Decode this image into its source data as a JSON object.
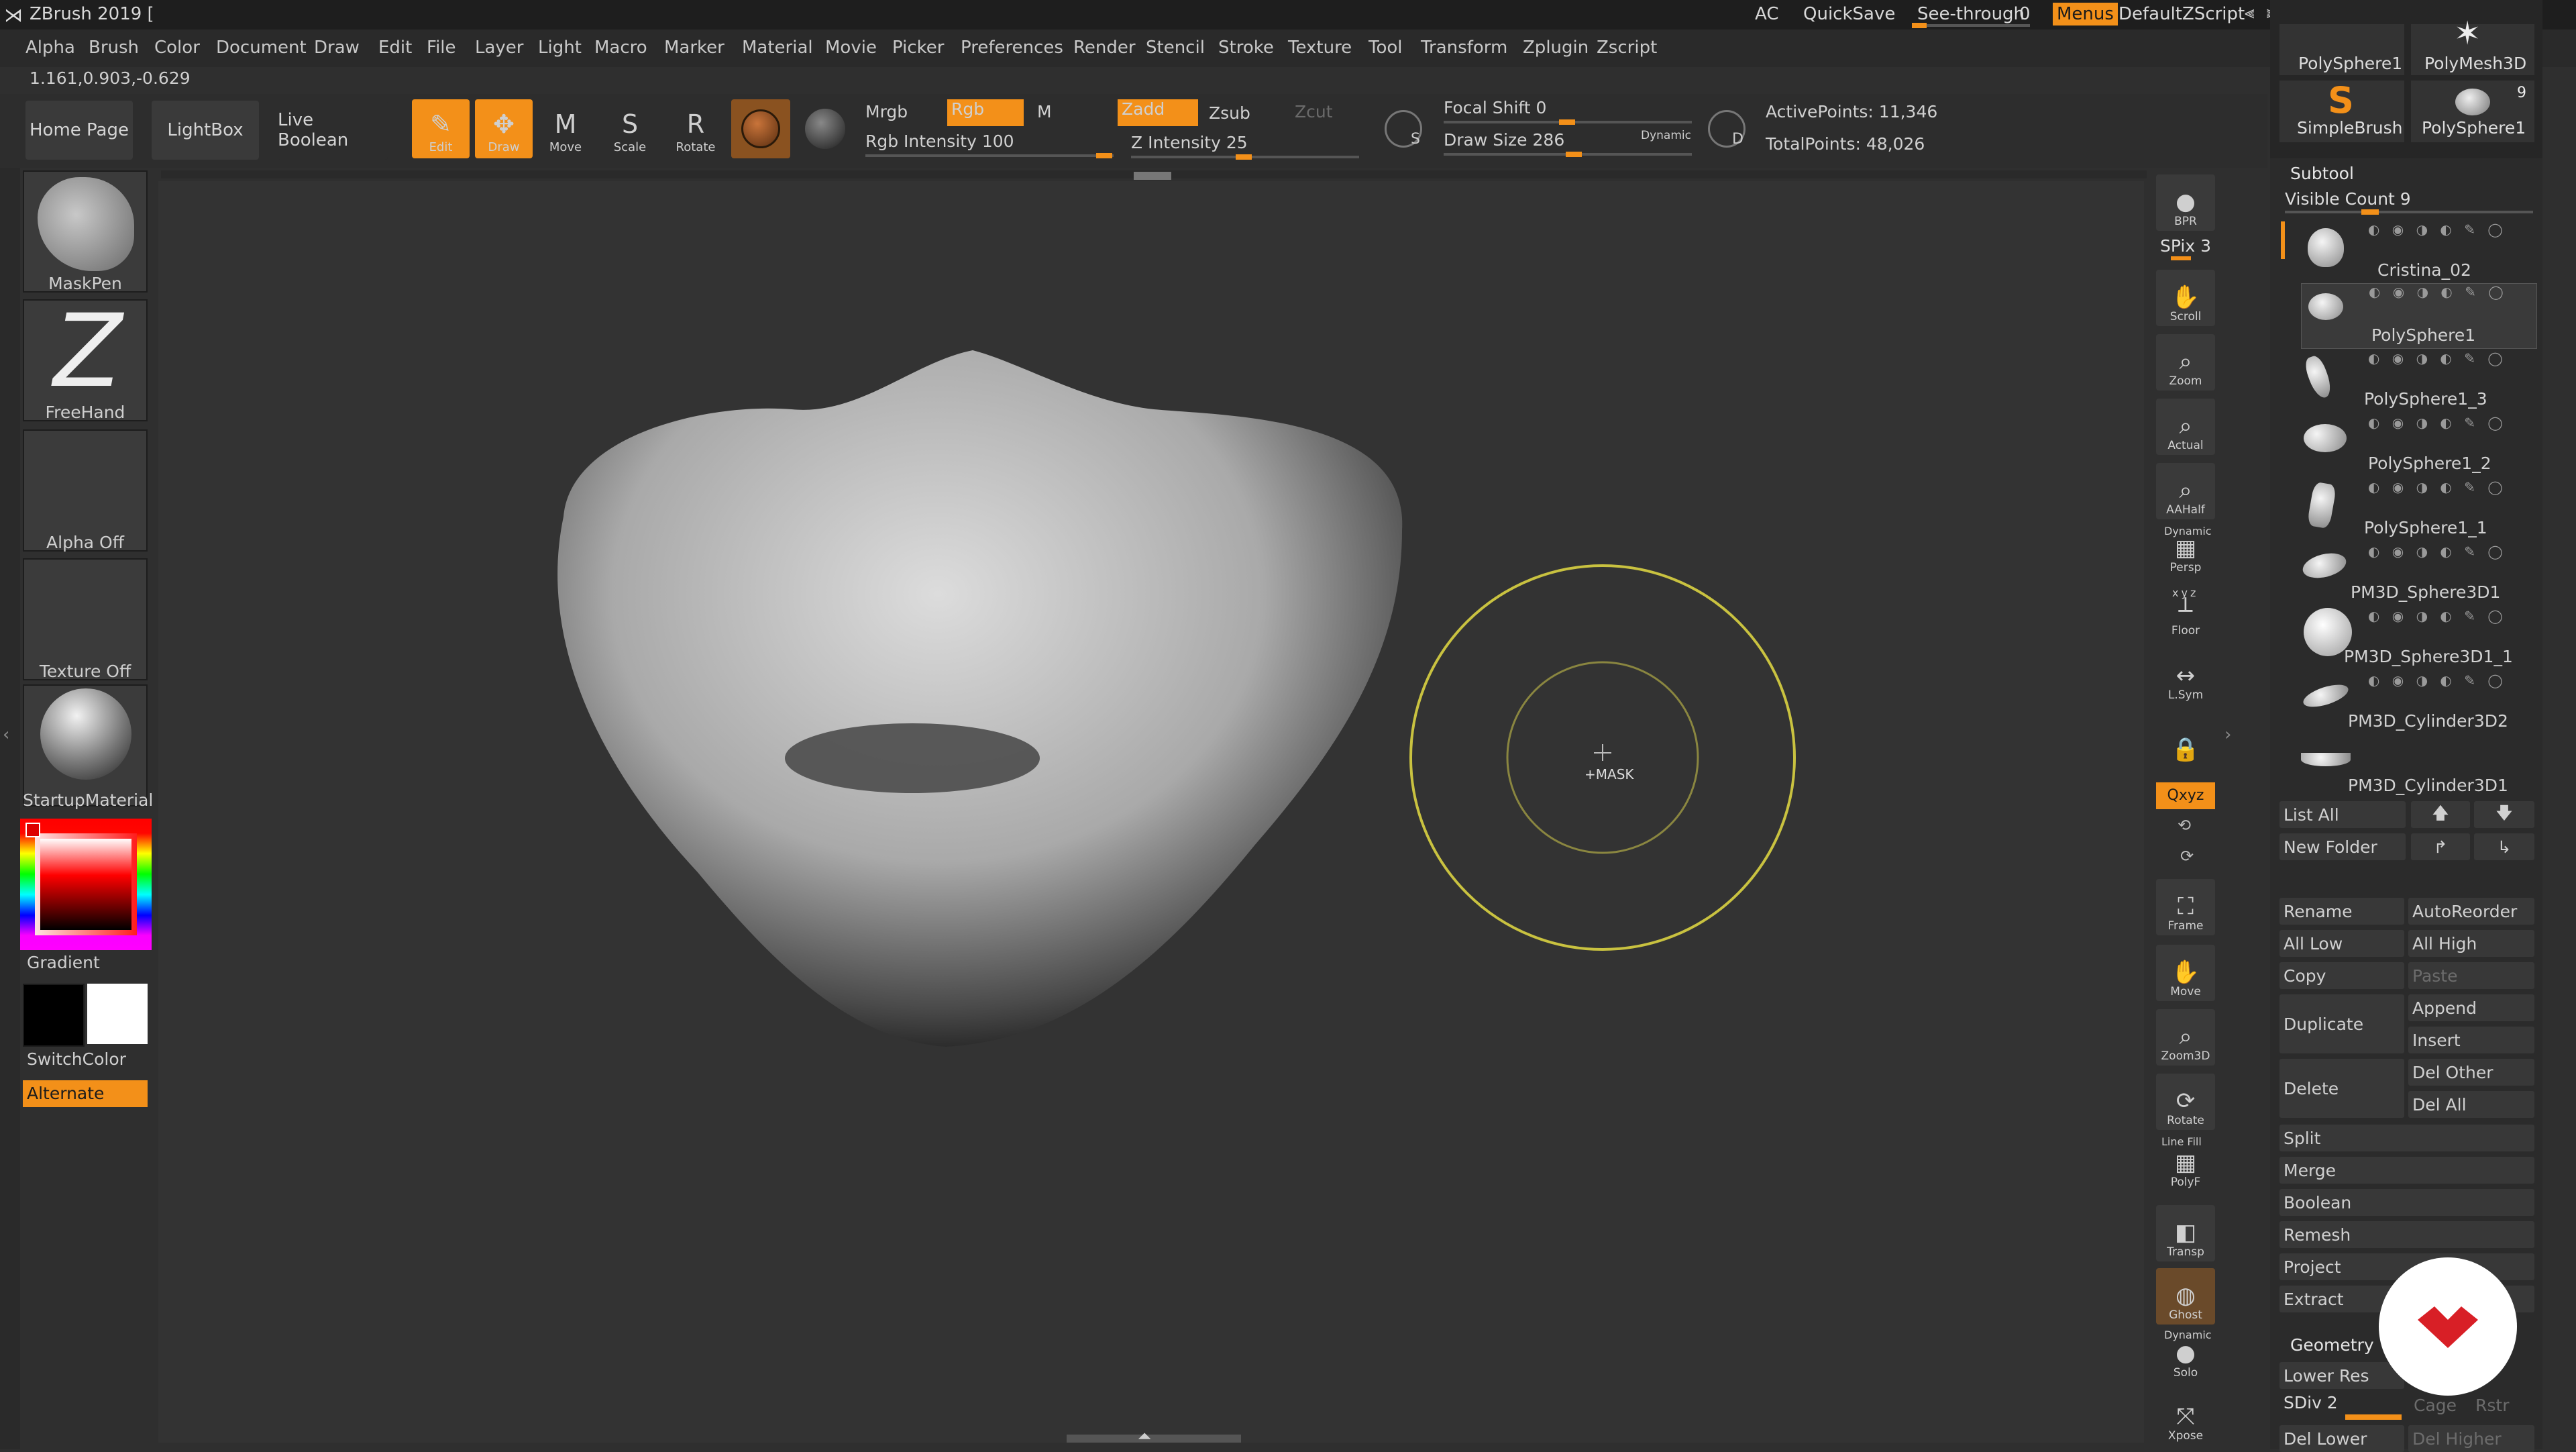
{
  "title": {
    "app_title": "ZBrush 2019 [",
    "ac": "AC",
    "quicksave": "QuickSave",
    "see_through": "See-through",
    "see_through_value": "0",
    "menus": "Menus",
    "script": "DefaultZScript"
  },
  "menus": [
    "Alpha",
    "Brush",
    "Color",
    "Document",
    "Draw",
    "Edit",
    "File",
    "Layer",
    "Light",
    "Macro",
    "Marker",
    "Material",
    "Movie",
    "Picker",
    "Preferences",
    "Render",
    "Stencil",
    "Stroke",
    "Texture",
    "Tool",
    "Transform",
    "Zplugin",
    "Zscript"
  ],
  "coords": "1.161,0.903,-0.629",
  "shelf": {
    "home_page": "Home Page",
    "lightbox": "LightBox",
    "live_boolean": "Live Boolean",
    "tools": [
      {
        "label": "Edit",
        "glyph": "✎",
        "active": true
      },
      {
        "label": "Draw",
        "glyph": "✥",
        "active": true
      },
      {
        "label": "Move",
        "glyph": "M",
        "active": false
      },
      {
        "label": "Scale",
        "glyph": "S",
        "active": false
      },
      {
        "label": "Rotate",
        "glyph": "R",
        "active": false
      }
    ],
    "mrgb": "Mrgb",
    "rgb": "Rgb",
    "m": "M",
    "rgb_intensity_label": "Rgb Intensity 100",
    "zadd": "Zadd",
    "zsub": "Zsub",
    "zcut": "Zcut",
    "z_intensity_label": "Z Intensity 25",
    "focal_shift_label": "Focal Shift 0",
    "draw_size_label": "Draw Size 286",
    "dynamic": "Dynamic",
    "s_badge": "S",
    "d_badge": "D",
    "active_points": "ActivePoints: 11,346",
    "total_points": "TotalPoints: 48,026"
  },
  "left_panel": {
    "maskpen": "MaskPen",
    "freehand": "FreeHand",
    "alpha_off": "Alpha Off",
    "texture_off": "Texture Off",
    "startup_material": "StartupMaterial",
    "gradient": "Gradient",
    "switch_color": "SwitchColor",
    "alternate": "Alternate"
  },
  "cursor_label": "+MASK",
  "right_toolbar": [
    {
      "label": "BPR",
      "glyph": "●"
    },
    {
      "label": "Scroll",
      "glyph": "✋"
    },
    {
      "label": "Zoom",
      "glyph": "⌕"
    },
    {
      "label": "Actual",
      "glyph": "⌕"
    },
    {
      "label": "AAHalf",
      "glyph": "⌕"
    },
    {
      "label": "Persp",
      "glyph": "▦"
    },
    {
      "label": "Floor",
      "glyph": "┴"
    },
    {
      "label": "L.Sym",
      "glyph": "↔"
    },
    {
      "label": "",
      "glyph": "🔒"
    },
    {
      "label": "Frame",
      "glyph": "⛶"
    },
    {
      "label": "Move",
      "glyph": "✋"
    },
    {
      "label": "Zoom3D",
      "glyph": "⌕"
    },
    {
      "label": "Rotate",
      "glyph": "⟳"
    },
    {
      "label": "PolyF",
      "glyph": "▦"
    },
    {
      "label": "Transp",
      "glyph": "◧"
    },
    {
      "label": "Ghost",
      "glyph": "◍"
    },
    {
      "label": "Solo",
      "glyph": "●"
    },
    {
      "label": "Xpose",
      "glyph": "⤧"
    }
  ],
  "right_toolbar_extra": {
    "spix": "SPix 3",
    "dynamic_persp": "Dynamic",
    "xyz_label": "xyz",
    "qxyz": "Qxyz",
    "line_fill": "Line Fill",
    "dynamic_solo": "Dynamic"
  },
  "tool_thumbs": {
    "polysphere1_top": "PolySphere1",
    "polymesh3d": "PolyMesh3D",
    "simplebrush": "SimpleBrush",
    "polysphere1_b": "PolySphere1",
    "count": "9"
  },
  "subtool": {
    "header": "Subtool",
    "visible_count": "Visible Count 9",
    "items": [
      "Cristina_02",
      "PolySphere1",
      "PolySphere1_3",
      "PolySphere1_2",
      "PolySphere1_1",
      "PM3D_Sphere3D1",
      "PM3D_Sphere3D1_1",
      "PM3D_Cylinder3D2",
      "PM3D_Cylinder3D1"
    ],
    "list_all": "List All",
    "new_folder": "New Folder",
    "rename": "Rename",
    "autoreorder": "AutoReorder",
    "all_low": "All Low",
    "all_high": "All High",
    "copy": "Copy",
    "paste": "Paste",
    "duplicate": "Duplicate",
    "append": "Append",
    "insert": "Insert",
    "delete": "Delete",
    "del_other": "Del Other",
    "del_all": "Del All",
    "split": "Split",
    "merge": "Merge",
    "boolean": "Boolean",
    "remesh": "Remesh",
    "project": "Project",
    "extract": "Extract"
  },
  "geometry": {
    "header": "Geometry",
    "lower_res": "Lower Res",
    "sdiv": "SDiv 2",
    "cage": "Cage",
    "rstr": "Rstr",
    "del_lower": "Del Lower",
    "del_higher": "Del Higher"
  },
  "colors": {
    "accent": "#f39019",
    "brush_ring": "#c9c240",
    "badge_red": "#d81f26"
  }
}
